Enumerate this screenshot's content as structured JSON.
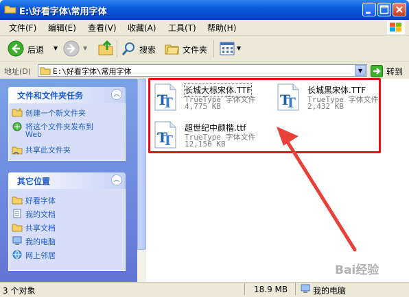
{
  "window": {
    "title": "E:\\好看字体\\常用字体"
  },
  "menu": [
    "文件(F)",
    "编辑(E)",
    "查看(V)",
    "收藏(A)",
    "工具(T)",
    "帮助(H)"
  ],
  "toolbar": {
    "back": "后退",
    "search": "搜索",
    "folders": "文件夹"
  },
  "address": {
    "label": "地址(D)",
    "path": "E:\\好看字体\\常用字体",
    "go": "转到"
  },
  "tasks": {
    "title": "文件和文件夹任务",
    "items": [
      "创建一个新文件夹",
      "将这个文件夹发布到",
      "Web",
      "共享此文件夹"
    ]
  },
  "places": {
    "title": "其它位置",
    "items": [
      "好看字体",
      "我的文档",
      "共享文档",
      "我的电脑",
      "网上邻居"
    ]
  },
  "files": [
    {
      "name": "长城大标宋体.TTF",
      "type": "TrueType 字体文件",
      "size": "4,775 KB"
    },
    {
      "name": "长城黑宋体.TTF",
      "type": "TrueType 字体文件",
      "size": "2,432 KB"
    },
    {
      "name": "超世纪中颜楷.ttf",
      "type": "TrueType 字体文件",
      "size": "12,156 KB"
    }
  ],
  "status": {
    "objects": "3 个对象",
    "size": "18.9 MB",
    "location": "我的电脑"
  },
  "watermark": "Bai经验",
  "colors": {
    "accent": "#0a5bdc",
    "highlight": "#e01414",
    "link": "#215dc6"
  }
}
